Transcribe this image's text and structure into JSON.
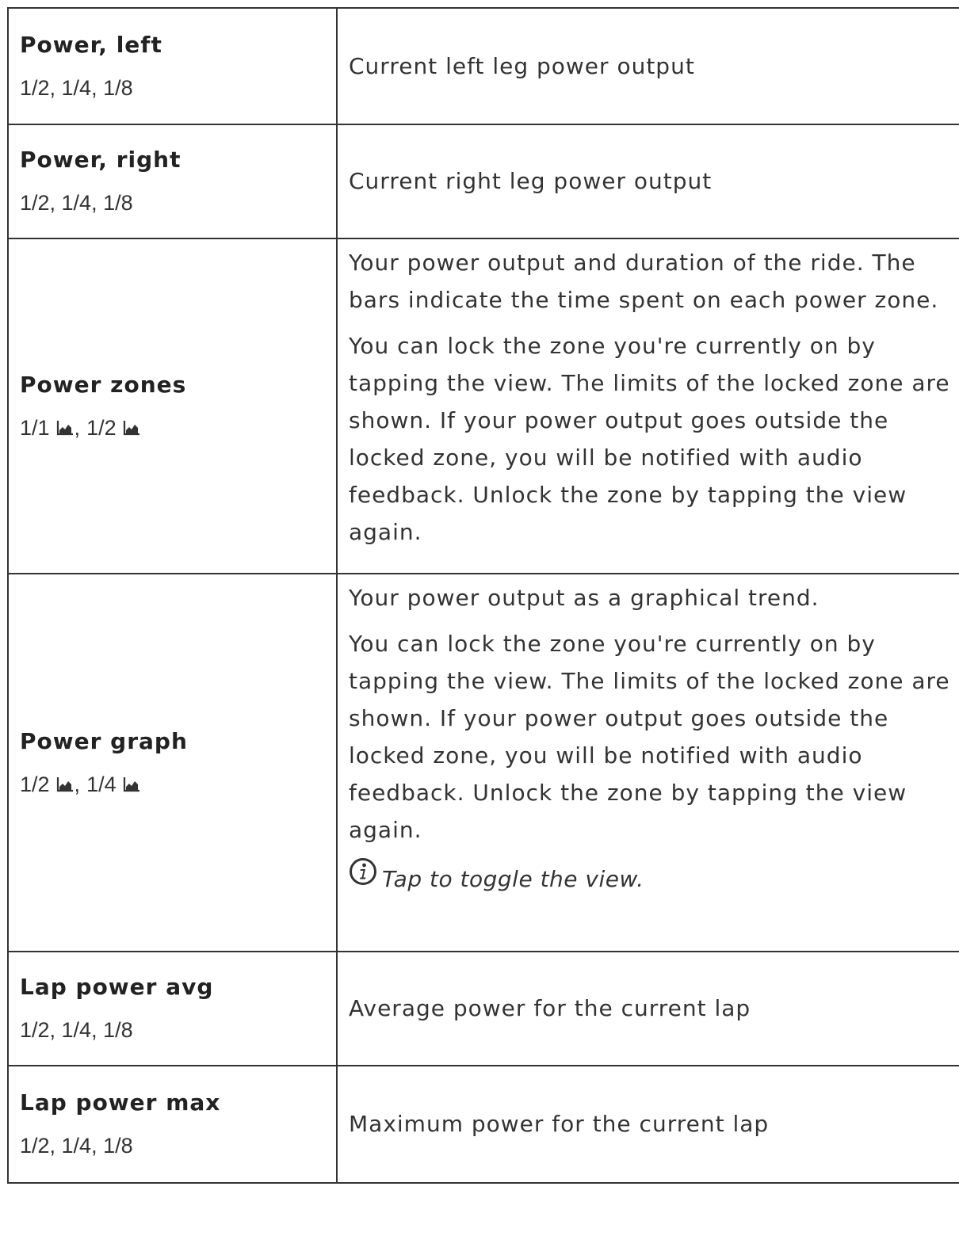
{
  "rows": [
    {
      "name": "Power, left",
      "sizes": "1/2, 1/4, 1/8",
      "description": "Current left leg power output"
    },
    {
      "name": "Power, right",
      "sizes": "1/2, 1/4, 1/8",
      "description": "Current right leg power output"
    },
    {
      "name": "Power zones",
      "size_a": "1/1",
      "size_b": "1/2",
      "separator": ",",
      "icon": "chart-icon",
      "para1": "Your power output and duration of the ride. The bars indicate the time spent on each power zone.",
      "para2": "You can lock the zone you're currently on by tapping the view. The limits of the locked zone are shown. If your power output goes outside the locked zone, you will be notified with audio feedback. Unlock the zone by tapping the view again."
    },
    {
      "name": "Power graph",
      "size_a": "1/2",
      "size_b": "1/4",
      "separator": ",",
      "icon": "chart-icon",
      "para1": "Your power output as a graphical trend.",
      "para2": "You can lock the zone you're currently on by tapping the view. The limits of the locked zone are shown. If your power output goes outside the locked zone, you will be notified with audio feedback. Unlock the zone by tapping the view again.",
      "tip_icon": "info-icon",
      "tip": "Tap to toggle the view."
    },
    {
      "name": "Lap power avg",
      "sizes": "1/2, 1/4, 1/8",
      "description": "Average power for the current lap"
    },
    {
      "name": "Lap power max",
      "sizes": "1/2, 1/4, 1/8",
      "description": "Maximum power for the current lap"
    }
  ]
}
